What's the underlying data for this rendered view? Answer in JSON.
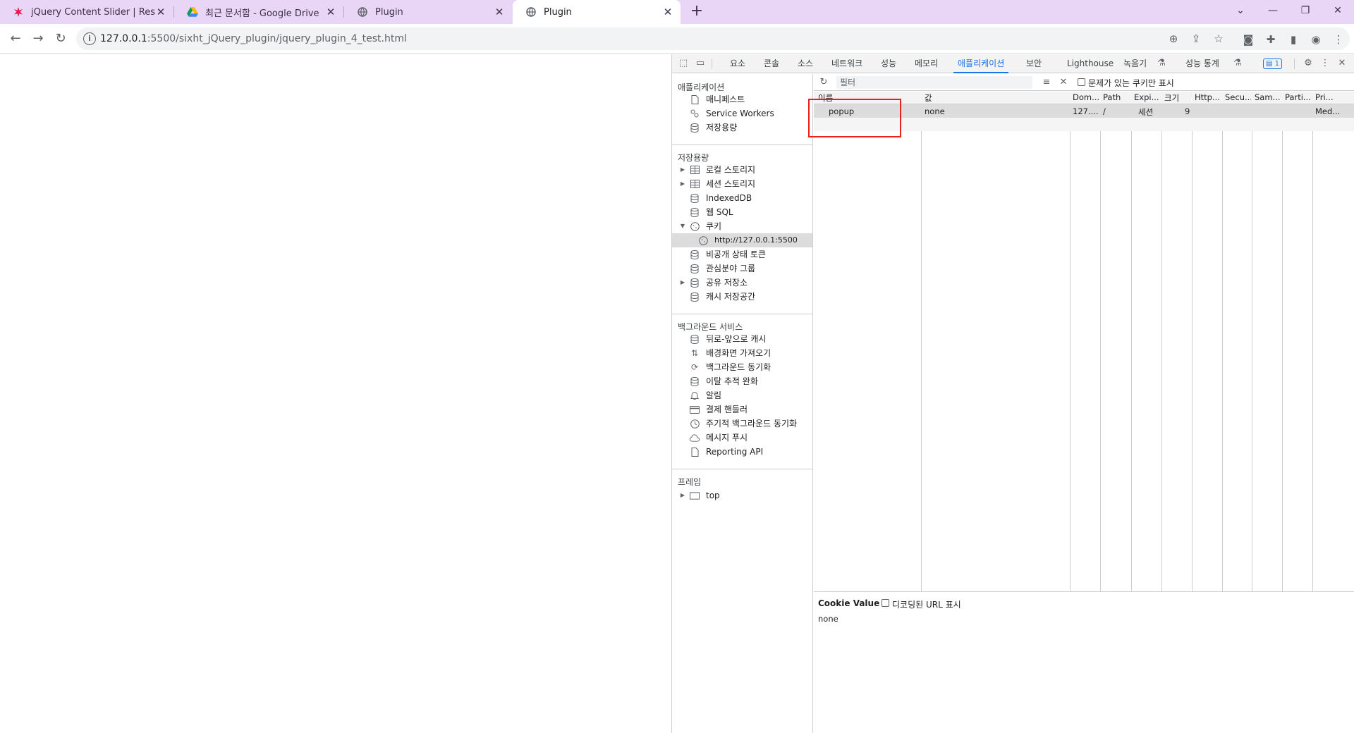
{
  "tabs": [
    {
      "title": "jQuery Content Slider | Respons",
      "favicon": "star-burst-icon",
      "favicon_color": "#e8194b"
    },
    {
      "title": "최근 문서함 - Google Drive",
      "favicon": "google-drive-icon"
    },
    {
      "title": "Plugin",
      "favicon": "globe-icon"
    },
    {
      "title": "Plugin",
      "favicon": "globe-icon",
      "active": true
    }
  ],
  "address_bar": {
    "host": "127.0.0.1",
    "path": ":5500/sixht_jQuery_plugin/jquery_plugin_4_test.html"
  },
  "devtools": {
    "tabs": [
      "요소",
      "콘솔",
      "소스",
      "네트워크",
      "성능",
      "메모리",
      "애플리케이션",
      "보안",
      "Lighthouse",
      "녹음기",
      "성능 통계"
    ],
    "active_tab": "애플리케이션",
    "issues_count": "1",
    "sidebar": {
      "application": {
        "title": "애플리케이션",
        "items": [
          "매니페스트",
          "Service Workers",
          "저장용량"
        ]
      },
      "storage": {
        "title": "저장용량",
        "items": [
          "로컬 스토리지",
          "세션 스토리지",
          "IndexedDB",
          "웹 SQL",
          "쿠키",
          "http://127.0.0.1:5500",
          "비공개 상태 토큰",
          "관심분야 그룹",
          "공유 저장소",
          "캐시 저장공간"
        ]
      },
      "background": {
        "title": "백그라운드 서비스",
        "items": [
          "뒤로-앞으로 캐시",
          "배경화면 가져오기",
          "백그라운드 동기화",
          "이탈 추적 완화",
          "알림",
          "결제 핸들러",
          "주기적 백그라운드 동기화",
          "메시지 푸시",
          "Reporting API"
        ]
      },
      "frames": {
        "title": "프레임",
        "items": [
          "top"
        ]
      }
    },
    "cookies": {
      "filter_placeholder": "필터",
      "only_issues_label": "문제가 있는 쿠키만 표시",
      "columns": [
        "이름",
        "값",
        "Dom...",
        "Path",
        "Expi...",
        "크기",
        "Http...",
        "Secu...",
        "Sam...",
        "Parti...",
        "Pri..."
      ],
      "rows": [
        {
          "name": "popup",
          "value": "none",
          "domain": "127....",
          "path": "/",
          "expires": "세션",
          "size": "9",
          "http": "",
          "secure": "",
          "samesite": "",
          "partition": "",
          "priority": "Med..."
        }
      ],
      "value_pane": {
        "title": "Cookie Value",
        "decoded_label": "디코딩된 URL 표시",
        "value": "none"
      }
    }
  }
}
